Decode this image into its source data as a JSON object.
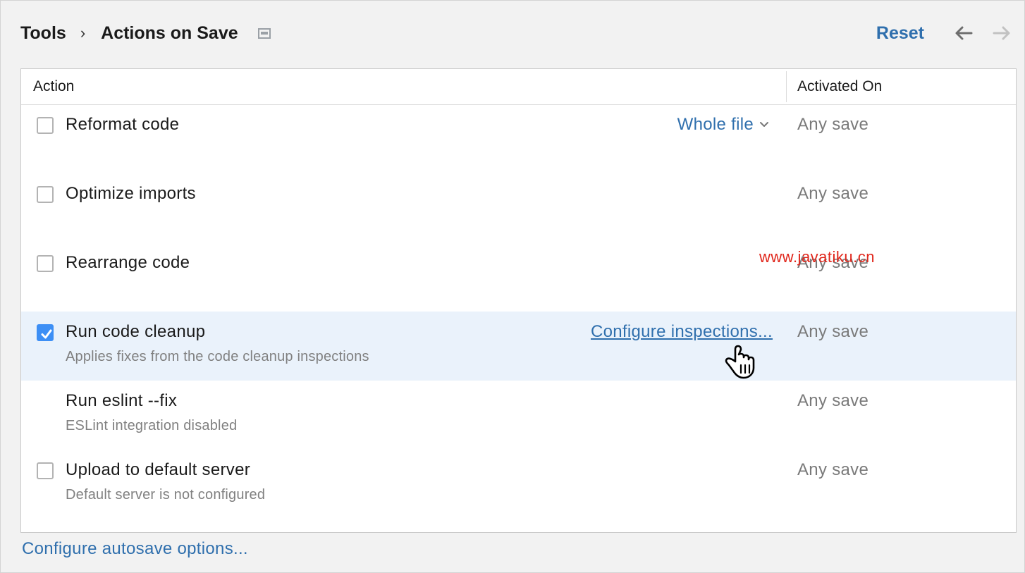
{
  "breadcrumb": {
    "parent": "Tools",
    "separator": "›",
    "current": "Actions on Save"
  },
  "header": {
    "reset_label": "Reset"
  },
  "table": {
    "columns": {
      "action": "Action",
      "activated_on": "Activated On"
    },
    "rows": [
      {
        "title": "Reformat code",
        "subtitle": "",
        "checked": false,
        "has_checkbox": true,
        "option_label": "Whole file",
        "activated_on": "Any save"
      },
      {
        "title": "Optimize imports",
        "subtitle": "",
        "checked": false,
        "has_checkbox": true,
        "activated_on": "Any save"
      },
      {
        "title": "Rearrange code",
        "subtitle": "",
        "checked": false,
        "has_checkbox": true,
        "activated_on": "Any save"
      },
      {
        "title": "Run code cleanup",
        "subtitle": "Applies fixes from the code cleanup inspections",
        "checked": true,
        "has_checkbox": true,
        "selected": true,
        "link_label": "Configure inspections...",
        "activated_on": "Any save"
      },
      {
        "title": "Run eslint --fix",
        "subtitle": "ESLint integration disabled",
        "checked": false,
        "has_checkbox": false,
        "activated_on": "Any save"
      },
      {
        "title": "Upload to default server",
        "subtitle": "Default server is not configured",
        "checked": false,
        "has_checkbox": true,
        "activated_on": "Any save"
      }
    ]
  },
  "footer": {
    "autosave_link": "Configure autosave options..."
  },
  "watermark": "www.javatiku.cn",
  "icons": {
    "page_icon": "settings-page-icon",
    "back": "arrow-left-icon",
    "forward": "arrow-right-icon",
    "dropdown": "chevron-down-icon",
    "checkmark": "checkmark-icon",
    "cursor": "hand-pointer-cursor-icon"
  },
  "colors": {
    "link": "#2f6fad",
    "checkbox_checked": "#3d8ff5",
    "row_selected": "#eaf2fb",
    "watermark": "#e0261b"
  }
}
